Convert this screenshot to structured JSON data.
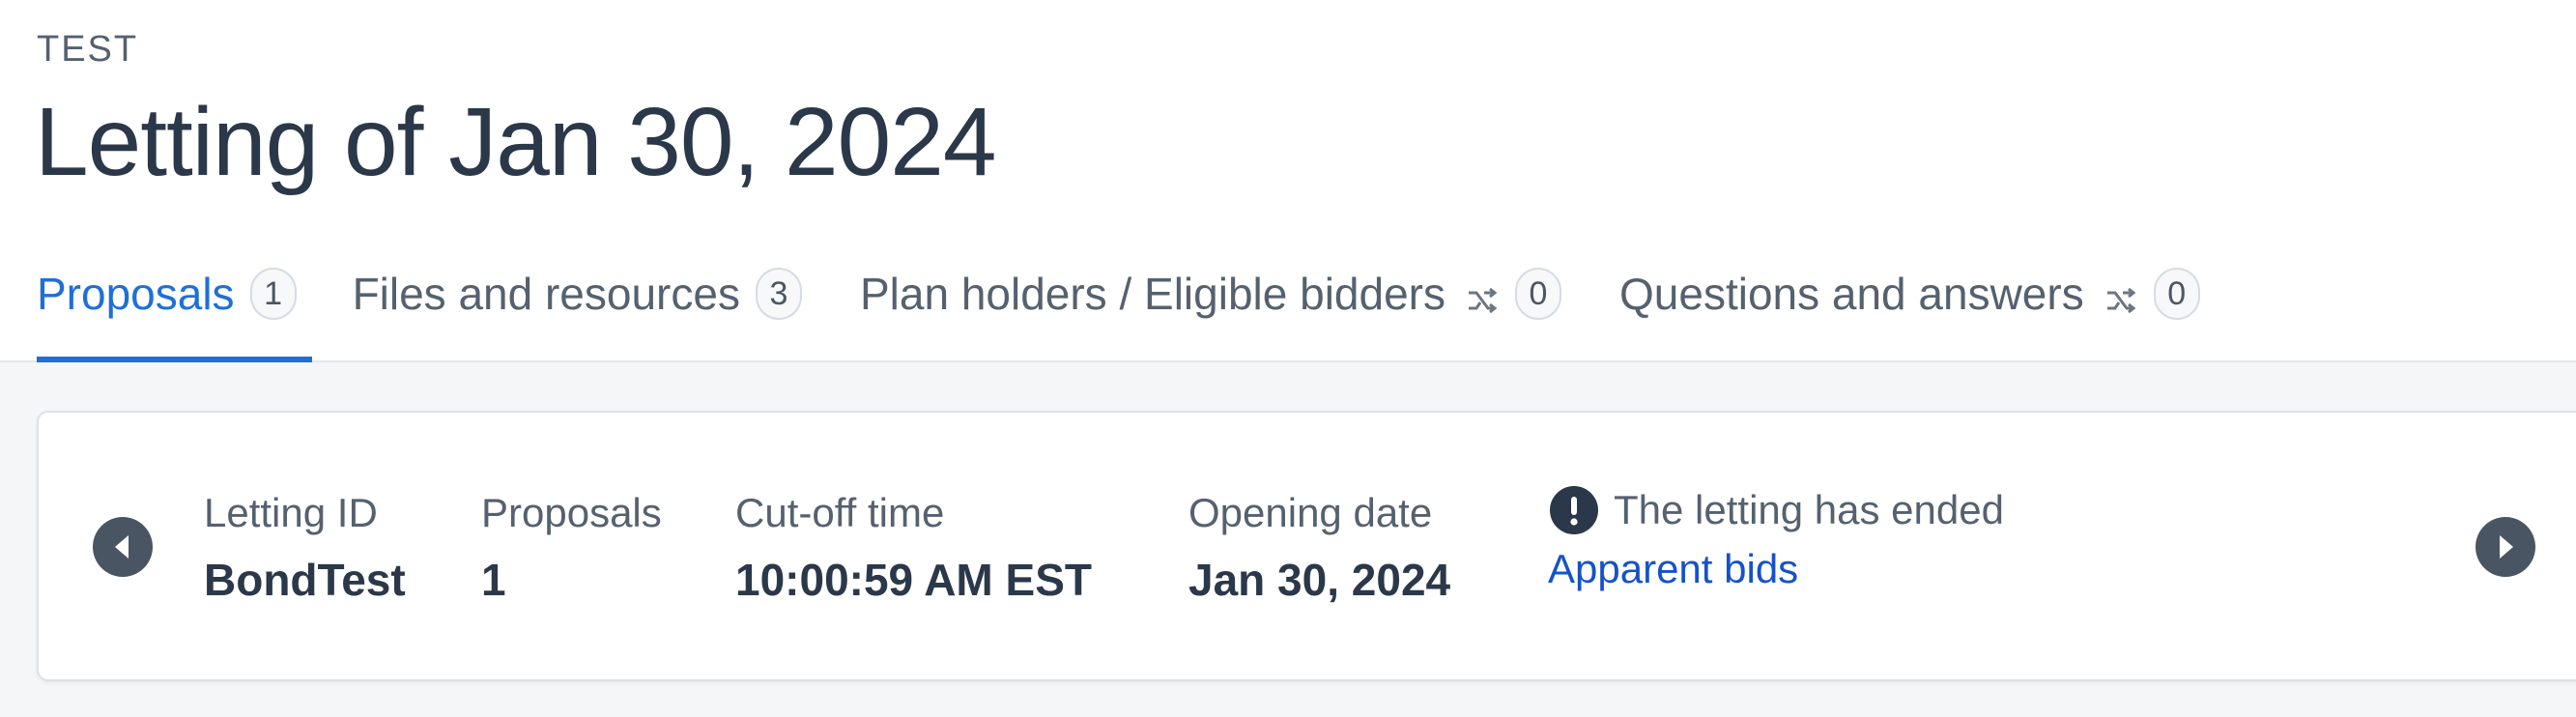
{
  "header": {
    "eyebrow": "TEST",
    "title": "Letting of Jan 30, 2024"
  },
  "tabs": [
    {
      "label": "Proposals",
      "count": "1",
      "active": true,
      "shared_icon": false
    },
    {
      "label": "Files and resources",
      "count": "3",
      "active": false,
      "shared_icon": false
    },
    {
      "label": "Plan holders / Eligible bidders",
      "count": "0",
      "active": false,
      "shared_icon": true
    },
    {
      "label": "Questions and answers",
      "count": "0",
      "active": false,
      "shared_icon": true
    }
  ],
  "summary": {
    "letting_id": {
      "label": "Letting ID",
      "value": "BondTest"
    },
    "proposals": {
      "label": "Proposals",
      "value": "1"
    },
    "cutoff": {
      "label": "Cut-off time",
      "value": "10:00:59 AM EST"
    },
    "opening": {
      "label": "Opening date",
      "value": "Jan 30, 2024"
    },
    "status_text": "The letting has ended",
    "status_link": "Apparent bids"
  },
  "colors": {
    "accent": "#1f6fd6",
    "link": "#1552c9",
    "text_dark": "#2b3849",
    "text_muted": "#56616f",
    "icon_dark": "#4a5563"
  },
  "icons": {
    "prev": "chevron-left-circle-icon",
    "next": "chevron-right-circle-icon",
    "alert": "exclamation-circle-icon",
    "shared": "share-branch-icon"
  }
}
